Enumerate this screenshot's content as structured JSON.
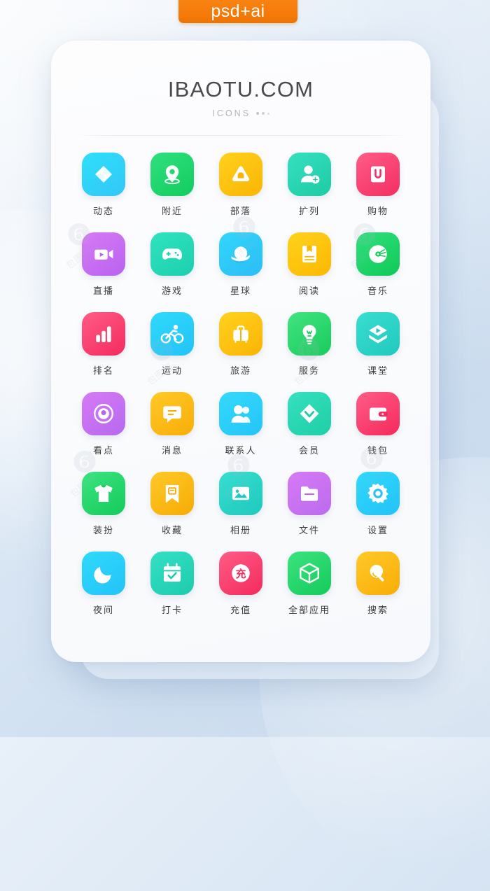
{
  "tag": {
    "label": "psd+ai",
    "color": "#f7800e"
  },
  "card": {
    "title": "IBAOTU.COM",
    "subtitle": "ICONS"
  },
  "watermark": {
    "text": "包图网"
  },
  "icons": [
    {
      "label": "动态",
      "icon": "pinwheel-icon",
      "bg_start": "#2ee0fa",
      "bg_end": "#32c6f7"
    },
    {
      "label": "附近",
      "icon": "location-pin-icon",
      "bg_start": "#2fe07e",
      "bg_end": "#12cc5f"
    },
    {
      "label": "部落",
      "icon": "tribe-tent-icon",
      "bg_start": "#ffd21e",
      "bg_end": "#fbb403"
    },
    {
      "label": "扩列",
      "icon": "add-friend-icon",
      "bg_start": "#35e0bf",
      "bg_end": "#1ecba5"
    },
    {
      "label": "购物",
      "icon": "shopping-u-icon",
      "bg_start": "#ff5c87",
      "bg_end": "#f32d62"
    },
    {
      "label": "直播",
      "icon": "live-video-icon",
      "bg_start": "#d77af5",
      "bg_end": "#b862ef"
    },
    {
      "label": "游戏",
      "icon": "gamepad-icon",
      "bg_start": "#2fe3c0",
      "bg_end": "#1ccfae"
    },
    {
      "label": "星球",
      "icon": "planet-icon",
      "bg_start": "#33d6fb",
      "bg_end": "#2bbdf6"
    },
    {
      "label": "阅读",
      "icon": "book-icon",
      "bg_start": "#ffd21e",
      "bg_end": "#fcb800"
    },
    {
      "label": "音乐",
      "icon": "music-disc-icon",
      "bg_start": "#2fe07e",
      "bg_end": "#10c957"
    },
    {
      "label": "排名",
      "icon": "bar-chart-icon",
      "bg_start": "#ff5c87",
      "bg_end": "#f42a5c"
    },
    {
      "label": "运动",
      "icon": "cyclist-icon",
      "bg_start": "#2fd9fb",
      "bg_end": "#22c3f8"
    },
    {
      "label": "旅游",
      "icon": "luggage-icon",
      "bg_start": "#ffd21e",
      "bg_end": "#fbb403"
    },
    {
      "label": "服务",
      "icon": "lightbulb-icon",
      "bg_start": "#41e481",
      "bg_end": "#19cb5c"
    },
    {
      "label": "课堂",
      "icon": "graduation-play-icon",
      "bg_start": "#38ded0",
      "bg_end": "#21c9bd"
    },
    {
      "label": "看点",
      "icon": "eye-circle-icon",
      "bg_start": "#d77af5",
      "bg_end": "#b668ef"
    },
    {
      "label": "消息",
      "icon": "chat-bubble-icon",
      "bg_start": "#ffc928",
      "bg_end": "#f9ad07"
    },
    {
      "label": "联系人",
      "icon": "contacts-icon",
      "bg_start": "#35d9fb",
      "bg_end": "#24c4f8"
    },
    {
      "label": "会员",
      "icon": "diamond-vip-icon",
      "bg_start": "#35e0bf",
      "bg_end": "#1ecfa6"
    },
    {
      "label": "钱包",
      "icon": "wallet-icon",
      "bg_start": "#ff5c87",
      "bg_end": "#f42a5c"
    },
    {
      "label": "装扮",
      "icon": "tshirt-icon",
      "bg_start": "#3ce37f",
      "bg_end": "#14cb5b"
    },
    {
      "label": "收藏",
      "icon": "bookmark-icon",
      "bg_start": "#ffc928",
      "bg_end": "#f7ab05"
    },
    {
      "label": "相册",
      "icon": "photo-icon",
      "bg_start": "#38ded0",
      "bg_end": "#1fc9bd"
    },
    {
      "label": "文件",
      "icon": "folder-icon",
      "bg_start": "#d77af5",
      "bg_end": "#bb6bef"
    },
    {
      "label": "设置",
      "icon": "gear-icon",
      "bg_start": "#2fd9fb",
      "bg_end": "#23c2f8"
    },
    {
      "label": "夜间",
      "icon": "moon-icon",
      "bg_start": "#2fd9fb",
      "bg_end": "#24c3f8"
    },
    {
      "label": "打卡",
      "icon": "calendar-check-icon",
      "bg_start": "#35e0c4",
      "bg_end": "#1ecbad"
    },
    {
      "label": "充值",
      "icon": "recharge-icon",
      "bg_start": "#ff5c87",
      "bg_end": "#f42a5c"
    },
    {
      "label": "全部应用",
      "icon": "cube-icon",
      "bg_start": "#3ce37f",
      "bg_end": "#14cb5b"
    },
    {
      "label": "搜索",
      "icon": "search-icon",
      "bg_start": "#ffc928",
      "bg_end": "#f9ad07"
    }
  ]
}
